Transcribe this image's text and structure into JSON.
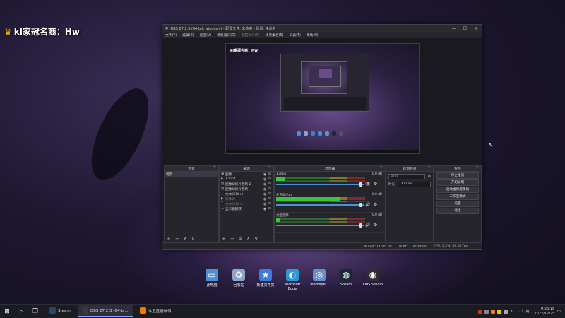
{
  "overlay": {
    "title": "kl家冠名商：Hw",
    "icon": "crown-icon"
  },
  "obs": {
    "window_title": "OBS 27.2.3 (64-bit, windows) - 配置文件: 未命名 - 场景: 未命名",
    "menu": [
      "文件(F)",
      "编辑(E)",
      "视图(V)",
      "停靠窗口(D)",
      "配置文件(P)",
      "场景集合(S)",
      "工具(T)",
      "帮助(H)"
    ],
    "menu_disabled_index": 4,
    "preview_title": "kl家冠名商：Hw",
    "no_source_selected": "未选择源",
    "scene_buttons": [
      "属性",
      "滤镜"
    ],
    "scenes": {
      "title": "场景",
      "items": [
        "场景"
      ]
    },
    "sources": {
      "title": "来源",
      "items": [
        {
          "label": "图像",
          "icon": "image-icon"
        },
        {
          "label": "1.mp4",
          "icon": "media-icon"
        },
        {
          "label": "图像幻灯片放映 2",
          "icon": "slideshow-icon"
        },
        {
          "label": "图像幻灯片放映",
          "icon": "slideshow-icon"
        },
        {
          "label": "文本(GDI+)",
          "icon": "text-icon"
        },
        {
          "label": "媒体源",
          "icon": "media-icon",
          "dim": true
        },
        {
          "label": "文本(GDI+)",
          "icon": "text-icon",
          "dim": true
        },
        {
          "label": "显示器捕获",
          "icon": "monitor-icon"
        }
      ]
    },
    "mixer": {
      "title": "混音器",
      "channels": [
        {
          "name": "1.mp4",
          "db": "0.0 dB",
          "level": 0.1,
          "muted": true
        },
        {
          "name": "麦克风/Aux",
          "db": "0.0 dB",
          "level": 0.72,
          "muted": false
        },
        {
          "name": "桌面音频",
          "db": "0.0 dB",
          "level": 0.05,
          "muted": false
        }
      ]
    },
    "transitions": {
      "title": "转场特效",
      "type": "淡出",
      "duration_label": "时长",
      "duration": "300 ms"
    },
    "controls": {
      "title": "控件",
      "buttons": [
        "停止推流",
        "开始录制",
        "启动虚拟摄像机",
        "工作室模式",
        "设置",
        "退出"
      ]
    },
    "status": {
      "live": "LIVE: 00:00:00",
      "rec": "REC: 00:00:00",
      "cpu": "CPU: 5.2%, 60.00 fps"
    }
  },
  "desktop_icons": [
    {
      "label": "此电脑",
      "icon": "computer-icon",
      "color": "#4a90d9"
    },
    {
      "label": "回收站",
      "icon": "recycle-bin-icon",
      "color": "#8aa7c8"
    },
    {
      "label": "新建文件夹",
      "icon": "star-folder-icon",
      "color": "#3d7be0"
    },
    {
      "label": "Microsoft Edge",
      "icon": "edge-icon",
      "color": "#2d9ad6"
    },
    {
      "label": "Teamspe...",
      "icon": "teamspeak-icon",
      "color": "#6a8fc8"
    },
    {
      "label": "Steam",
      "icon": "steam-icon",
      "color": "#1b2838"
    },
    {
      "label": "OBS Studio",
      "icon": "obs-icon",
      "color": "#302e31"
    }
  ],
  "taskbar": {
    "apps": [
      {
        "label": "Steam",
        "icon": "steam-icon",
        "color": "#2a475e",
        "active": false
      },
      {
        "label": "OBS 27.2.3 (64-bi...",
        "icon": "obs-icon",
        "color": "#3a383c",
        "active": true
      },
      {
        "label": "斗鱼直播伴侣",
        "icon": "douyu-icon",
        "color": "#f57c00",
        "active": false
      }
    ],
    "time": "0:26:18",
    "date": "2022/12/25"
  }
}
